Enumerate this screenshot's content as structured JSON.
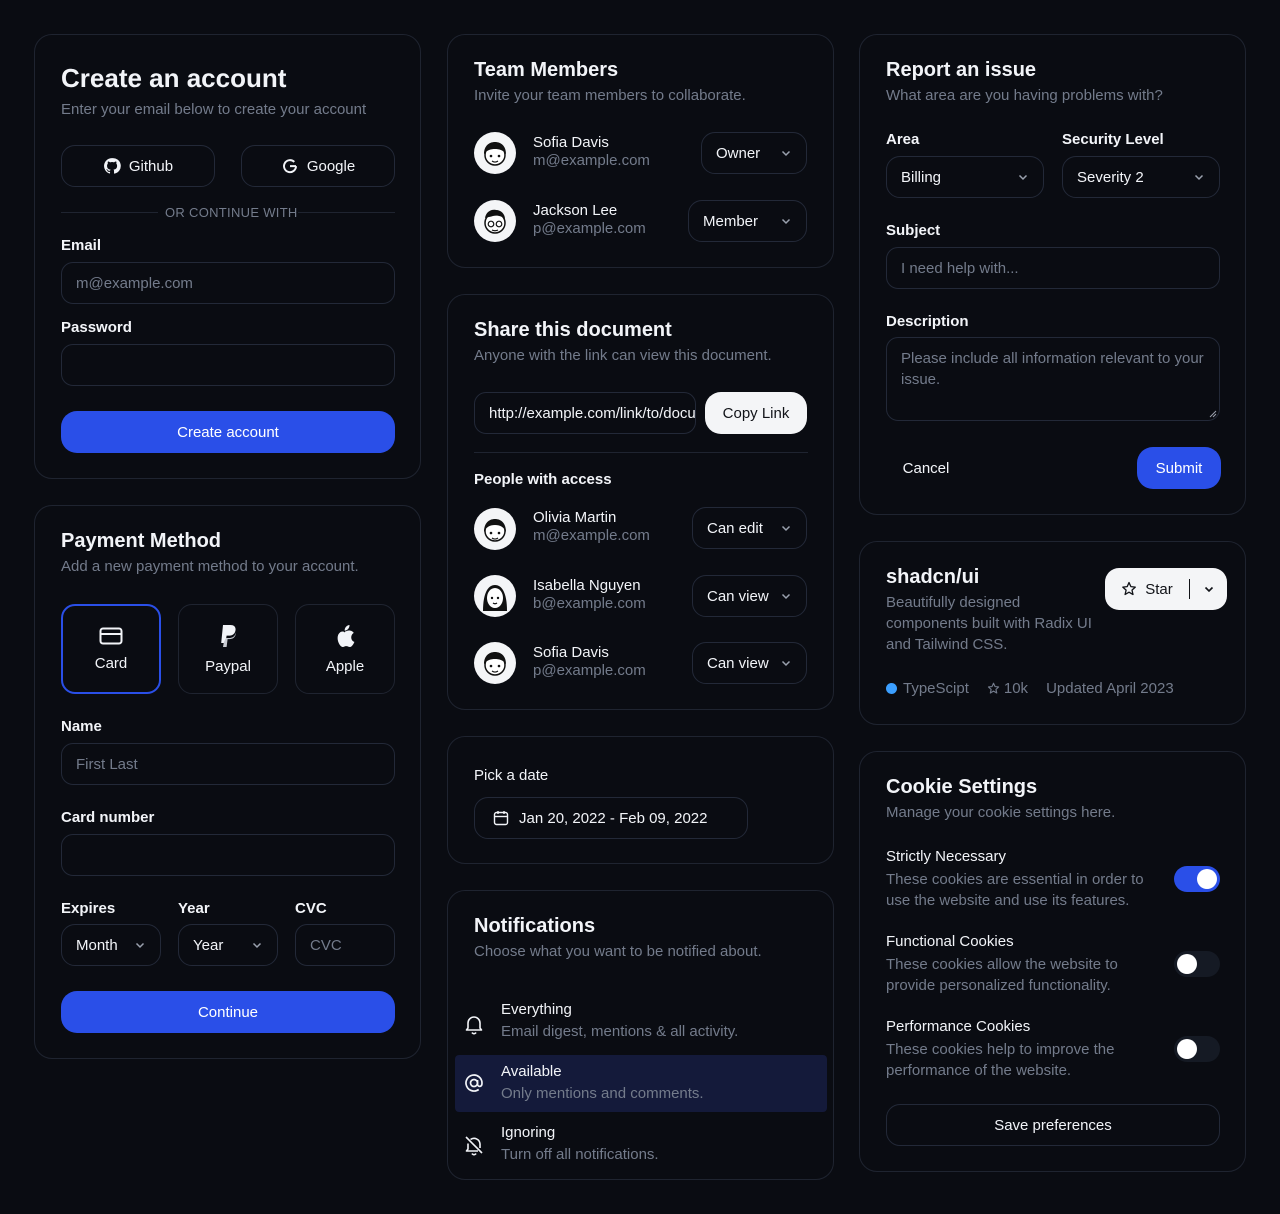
{
  "create_account": {
    "title": "Create an account",
    "subtitle": "Enter your email below to create your account",
    "github": "Github",
    "google": "Google",
    "divider": "OR CONTINUE WITH",
    "email_label": "Email",
    "email_placeholder": "m@example.com",
    "password_label": "Password",
    "submit": "Create account"
  },
  "payment": {
    "title": "Payment Method",
    "subtitle": "Add a new payment method to your account.",
    "options": [
      {
        "label": "Card",
        "icon": "credit-card-icon",
        "selected": true
      },
      {
        "label": "Paypal",
        "icon": "paypal-icon",
        "selected": false
      },
      {
        "label": "Apple",
        "icon": "apple-icon",
        "selected": false
      }
    ],
    "name_label": "Name",
    "name_placeholder": "First Last",
    "card_label": "Card number",
    "expires_label": "Expires",
    "year_label": "Year",
    "cvc_label": "CVC",
    "month_value": "Month",
    "year_value": "Year",
    "cvc_placeholder": "CVC",
    "continue": "Continue"
  },
  "team": {
    "title": "Team Members",
    "subtitle": "Invite your team members to collaborate.",
    "members": [
      {
        "name": "Sofia Davis",
        "email": "m@example.com",
        "role": "Owner"
      },
      {
        "name": "Jackson Lee",
        "email": "p@example.com",
        "role": "Member"
      }
    ]
  },
  "share": {
    "title": "Share this document",
    "subtitle": "Anyone with the link can view this document.",
    "link": "http://example.com/link/to/document",
    "copy": "Copy Link",
    "people_label": "People with access",
    "people": [
      {
        "name": "Olivia Martin",
        "email": "m@example.com",
        "perm": "Can edit"
      },
      {
        "name": "Isabella Nguyen",
        "email": "b@example.com",
        "perm": "Can view"
      },
      {
        "name": "Sofia Davis",
        "email": "p@example.com",
        "perm": "Can view"
      }
    ]
  },
  "date": {
    "label": "Pick a date",
    "range": "Jan 20, 2022 - Feb 09, 2022"
  },
  "notifications": {
    "title": "Notifications",
    "subtitle": "Choose what you want to be notified about.",
    "items": [
      {
        "title": "Everything",
        "desc": "Email digest, mentions & all activity.",
        "icon": "bell-icon"
      },
      {
        "title": "Available",
        "desc": "Only mentions and comments.",
        "icon": "at-sign-icon"
      },
      {
        "title": "Ignoring",
        "desc": "Turn off all notifications.",
        "icon": "bell-off-icon"
      }
    ]
  },
  "report": {
    "title": "Report an issue",
    "subtitle": "What area are you having problems with?",
    "area_label": "Area",
    "area_value": "Billing",
    "security_label": "Security Level",
    "security_value": "Severity 2",
    "subject_label": "Subject",
    "subject_placeholder": "I need help with...",
    "desc_label": "Description",
    "desc_placeholder": "Please include all information relevant to your issue.",
    "cancel": "Cancel",
    "submit": "Submit"
  },
  "repo": {
    "name": "shadcn/ui",
    "desc": "Beautifully designed components built with Radix UI and Tailwind CSS.",
    "star": "Star",
    "language": "TypeScipt",
    "stars": "10k",
    "updated": "Updated April 2023",
    "lang_color": "#3b9fff"
  },
  "cookies": {
    "title": "Cookie Settings",
    "subtitle": "Manage your cookie settings here.",
    "items": [
      {
        "title": "Strictly Necessary",
        "desc": "These cookies are essential in order to use the website and use its features.",
        "on": true
      },
      {
        "title": "Functional Cookies",
        "desc": "These cookies allow the website to provide personalized functionality.",
        "on": false
      },
      {
        "title": "Performance Cookies",
        "desc": "These cookies help to improve the performance of the website.",
        "on": false
      }
    ],
    "save": "Save preferences"
  },
  "colors": {
    "accent": "#2a4fe8",
    "highlight": "#141a3a"
  }
}
